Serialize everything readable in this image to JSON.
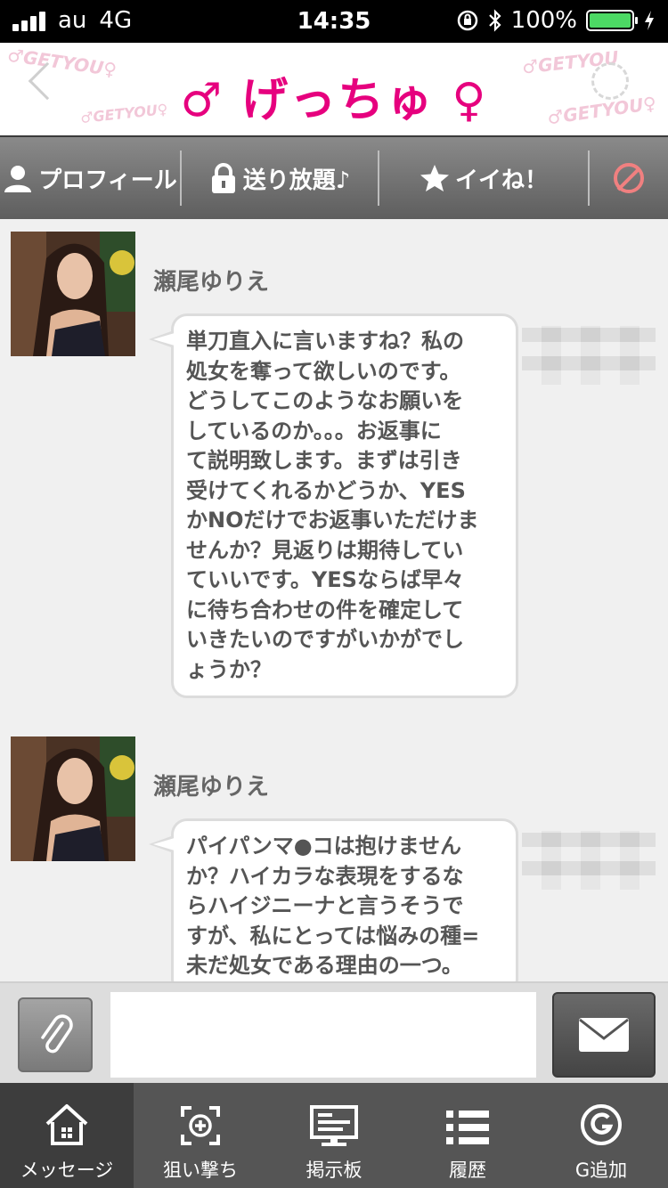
{
  "status_bar": {
    "carrier": "au",
    "network": "4G",
    "time": "14:35",
    "battery": "100%",
    "battery_level": 1.0
  },
  "header": {
    "title": "♂ げっちゅ ♀",
    "watermarks": [
      "♂GETYOU♀",
      "♂GETYOU♀",
      "♂GETYOU",
      "♂GETYOU♀"
    ]
  },
  "actions": {
    "profile": "プロフィール",
    "unlimited": "送り放題♪",
    "like": "イイね！"
  },
  "messages": [
    {
      "sender": "瀬尾ゆりえ",
      "text": "単刀直入に言いますね？私の\n処女を奪って欲しいのです。\nどうしてこのようなお願いを\nしているのか。。。お返事に\nて説明致します。まずは引き\n受けてくれるかどうか、YES\nかNOだけでお返事いただけま\nせんか？見返りは期待してい\nていいです。YESならば早々\nに待ち合わせの件を確定して\nいきたいのですがいかがでし\nょうか？"
    },
    {
      "sender": "瀬尾ゆりえ",
      "text": "パイパンマ●コは抱けません\nか？ハイカラな表現をするな\nらハイジニーナと言うそうで\nすが、私にとっては悩みの種=\n未だ処女である理由の一つ。"
    }
  ],
  "input": {
    "placeholder": ""
  },
  "tabs": [
    {
      "label": "メッセージ",
      "icon": "home-icon"
    },
    {
      "label": "狙い撃ち",
      "icon": "crosshair-icon"
    },
    {
      "label": "掲示板",
      "icon": "board-icon"
    },
    {
      "label": "履歴",
      "icon": "list-icon"
    },
    {
      "label": "G追加",
      "icon": "g-circle-icon"
    }
  ],
  "colors": {
    "brand_pink": "#e6007e",
    "battery_green": "#4cd964",
    "block_red": "#f08080"
  }
}
